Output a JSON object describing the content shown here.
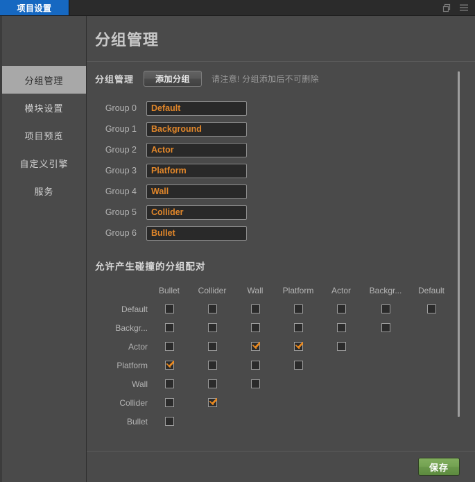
{
  "window": {
    "tab_label": "项目设置",
    "icons": {
      "restore": "restore-window-icon",
      "menu": "hamburger-menu-icon"
    }
  },
  "sidebar": {
    "items": [
      {
        "label": "分组管理",
        "active": true
      },
      {
        "label": "模块设置",
        "active": false
      },
      {
        "label": "项目预览",
        "active": false
      },
      {
        "label": "自定义引擎",
        "active": false
      },
      {
        "label": "服务",
        "active": false
      }
    ]
  },
  "page": {
    "title": "分组管理"
  },
  "toolbar": {
    "section_label": "分组管理",
    "add_group_label": "添加分组",
    "note": "请注意! 分组添加后不可删除"
  },
  "groups": [
    {
      "label": "Group 0",
      "value": "Default"
    },
    {
      "label": "Group 1",
      "value": "Background"
    },
    {
      "label": "Group 2",
      "value": "Actor"
    },
    {
      "label": "Group 3",
      "value": "Platform"
    },
    {
      "label": "Group 4",
      "value": "Wall"
    },
    {
      "label": "Group 5",
      "value": "Collider"
    },
    {
      "label": "Group 6",
      "value": "Bullet"
    }
  ],
  "matrix": {
    "title": "允许产生碰撞的分组配对",
    "columns": [
      "Bullet",
      "Collider",
      "Wall",
      "Platform",
      "Actor",
      "Backgr...",
      "Default"
    ],
    "rows": [
      {
        "label": "Default",
        "cells": [
          false,
          false,
          false,
          false,
          false,
          false,
          false
        ]
      },
      {
        "label": "Backgr...",
        "cells": [
          false,
          false,
          false,
          false,
          false,
          false
        ]
      },
      {
        "label": "Actor",
        "cells": [
          false,
          false,
          true,
          true,
          false
        ]
      },
      {
        "label": "Platform",
        "cells": [
          true,
          false,
          false,
          false
        ]
      },
      {
        "label": "Wall",
        "cells": [
          false,
          false,
          false
        ]
      },
      {
        "label": "Collider",
        "cells": [
          false,
          true
        ]
      },
      {
        "label": "Bullet",
        "cells": [
          false
        ]
      }
    ]
  },
  "footer": {
    "save_label": "保存"
  },
  "colors": {
    "accent_orange": "#e0862a",
    "tab_blue": "#1668c1",
    "save_green": "#74a252",
    "panel_bg": "#4a4a4a",
    "titlebar_bg": "#2b2b2b"
  }
}
